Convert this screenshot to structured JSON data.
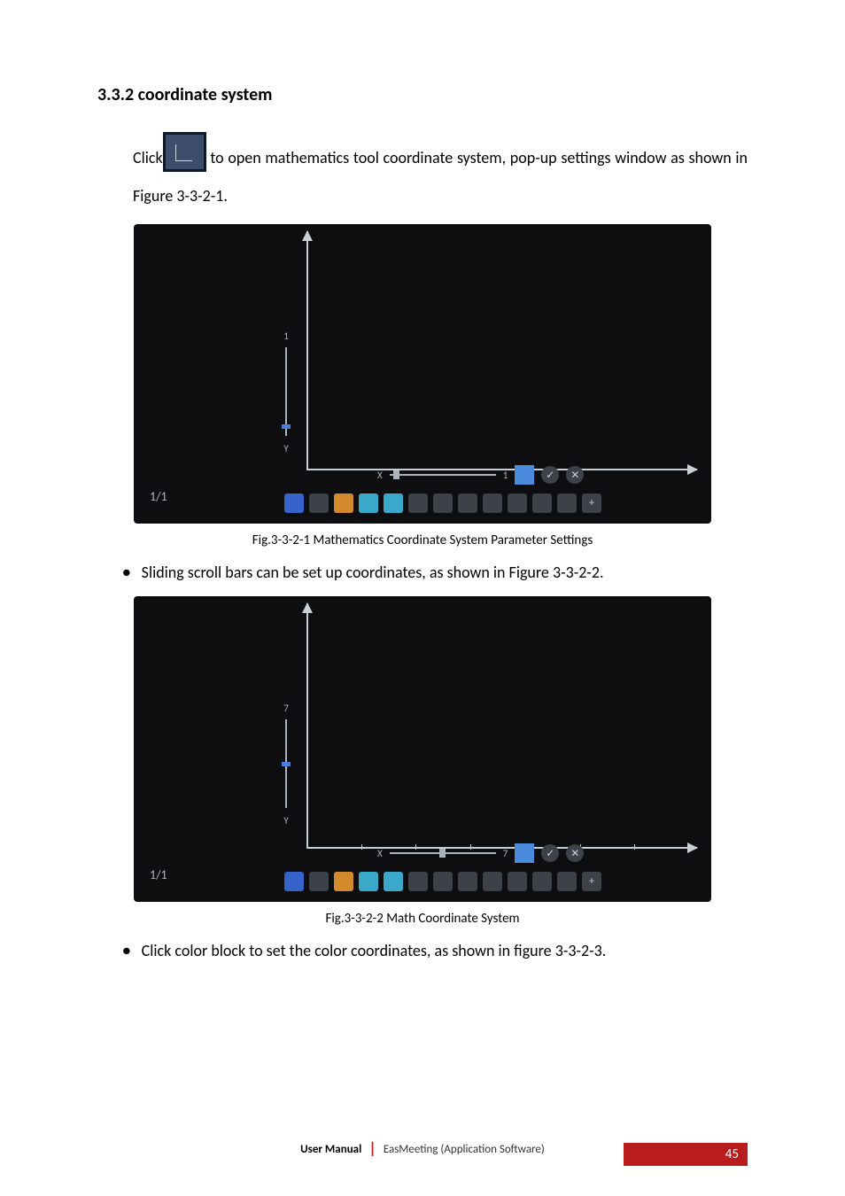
{
  "heading": "3.3.2 coordinate system",
  "para1_pre": "Click",
  "para1_post": " to open mathematics tool coordinate system, pop-up settings window as shown in Figure 3-3-2-1.",
  "fig1": {
    "caption": "Fig.3-3-2-1 Mathematics Coordinate System Parameter Settings",
    "page_counter": "1/1",
    "y_top": "1",
    "y_label": "Y",
    "x_label": "X",
    "x_value": "1"
  },
  "bullet1": "Sliding scroll bars can be set up coordinates, as shown in Figure 3-3-2-2.",
  "fig2": {
    "caption": "Fig.3-3-2-2 Math Coordinate System",
    "page_counter": "1/1",
    "y_top": "7",
    "y_label": "Y",
    "x_label": "X",
    "x_value": "7"
  },
  "bullet2": "Click color block to set the color coordinates, as shown in figure 3-3-2-3.",
  "footer": {
    "bold": "User Manual",
    "software": "EasMeeting (Application Software)",
    "page": "45"
  },
  "icons": {
    "check": "✓",
    "close": "✕",
    "plus": "+"
  }
}
